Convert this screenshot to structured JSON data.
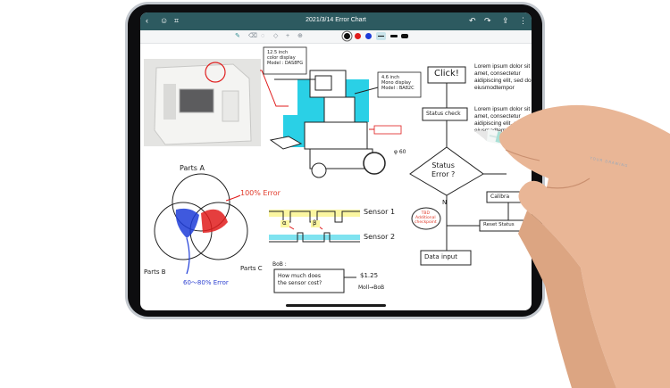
{
  "app": {
    "title": "2021/3/14 Error Chart"
  },
  "colors": {
    "toolbar_bg": "#2d5a60",
    "pen_black": "#111111",
    "pen_red": "#e01c1c",
    "pen_blue": "#1d3cd8"
  },
  "icons": [
    "back-icon",
    "people-icon",
    "scan-icon",
    "undo-icon",
    "redo-icon",
    "share-icon",
    "more-icon",
    "pen-icon",
    "eraser-icon",
    "lasso-icon",
    "shape-icon",
    "add-icon"
  ],
  "notes": {
    "photo_note": "12.5 inch\ncolor display\nModel : DAS8FG",
    "mono_note": "4.6 inch\nMono display\nModel : BA82C",
    "dim_note": "φ 60",
    "parts_a": "Parts A",
    "parts_b": "Parts B",
    "parts_c": "Parts C",
    "error_100": "100% Error",
    "error_60_80": "60～80% Error",
    "sensor_1": "Sensor 1",
    "sensor_2": "Sensor 2",
    "alpha": "α",
    "beta": "β",
    "bob": "BoB :",
    "question": "How much does\nthe sensor cost?",
    "price": "$1.25",
    "price_sub": "Moll→BoB",
    "click": "Click!",
    "status_check": "Status check",
    "status_error": "Status\nError ?",
    "n": "N",
    "calibra": "Calibra",
    "reset": "Reset Status",
    "tbd": "TBD\nAdditional\ncheckpoint",
    "data_input": "Data input",
    "lorem_1": "Lorem ipsum dolor sit amet, consectetur aidipiscing elit, sed do eiusmodtempor",
    "lorem_2": "Lorem ipsum dolor sit amet, consectetur aidipiscing elit, sed do eiusmodtempor",
    "pencil_brand": "YOUR DRAWING"
  }
}
